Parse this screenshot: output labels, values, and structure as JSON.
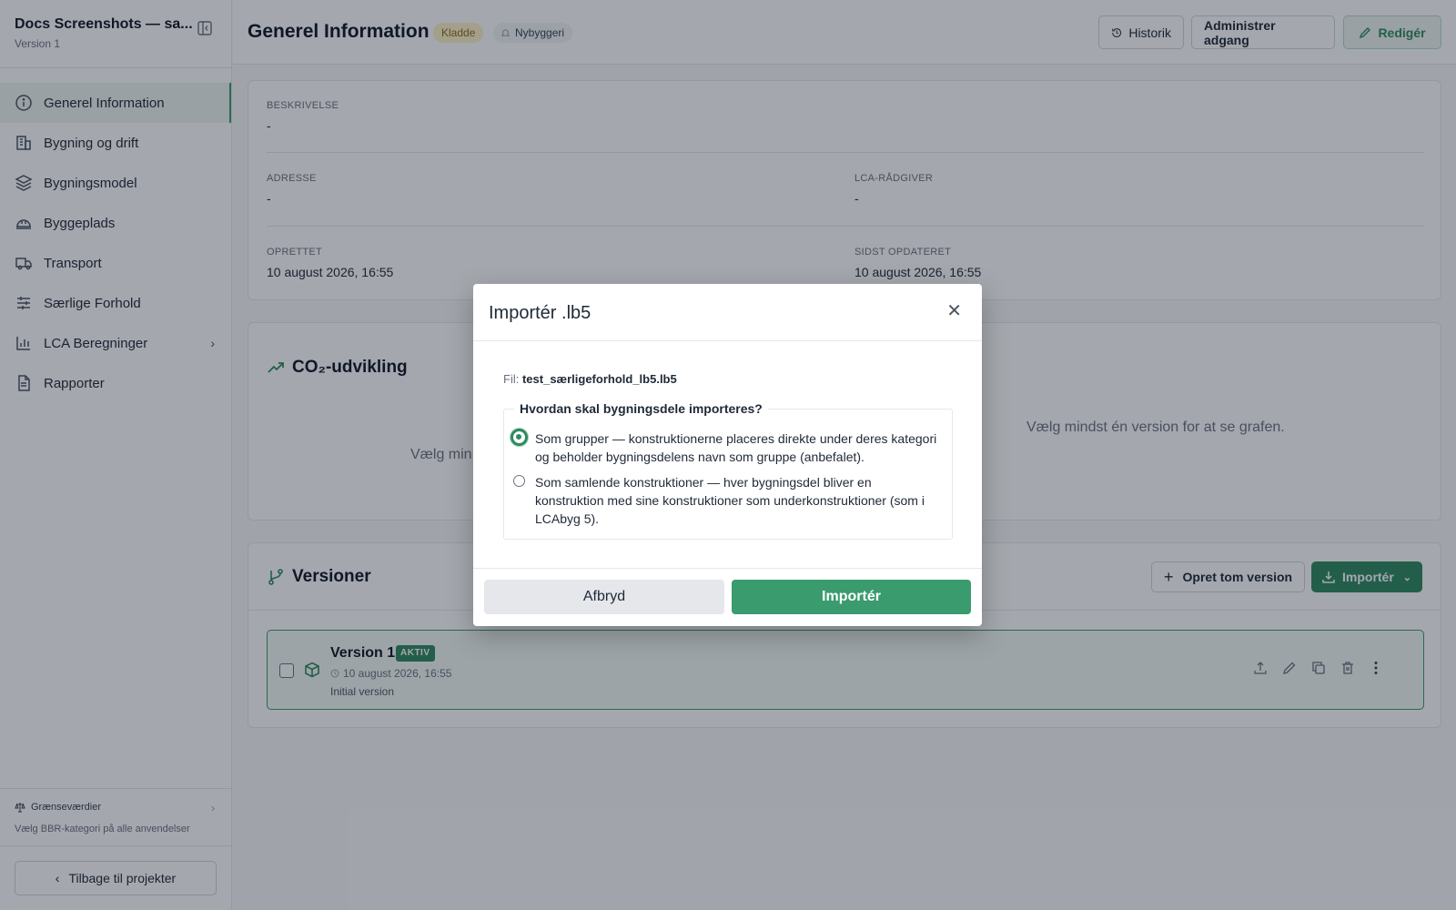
{
  "sidebar": {
    "title": "Docs Screenshots — sa...",
    "subtitle": "Version 1",
    "items": [
      {
        "label": "Generel Information"
      },
      {
        "label": "Bygning og drift"
      },
      {
        "label": "Bygningsmodel"
      },
      {
        "label": "Byggeplads"
      },
      {
        "label": "Transport"
      },
      {
        "label": "Særlige Forhold"
      },
      {
        "label": "LCA Beregninger"
      },
      {
        "label": "Rapporter"
      }
    ],
    "limits_title": "Grænseværdier",
    "limits_sub": "Vælg BBR-kategori på alle anvendelser",
    "back_label": "Tilbage til projekter"
  },
  "header": {
    "title": "Generel Information",
    "status_badge": "Kladde",
    "type_badge": "Nybyggeri",
    "history": "Historik",
    "admin": "Administrer adgang",
    "edit": "Redigér"
  },
  "info": {
    "desc_label": "BESKRIVELSE",
    "desc_value": "-",
    "address_label": "ADRESSE",
    "address_value": "-",
    "advisor_label": "LCA-RÅDGIVER",
    "advisor_value": "-",
    "created_label": "OPRETTET",
    "created_value": "10 august 2026, 16:55",
    "updated_label": "SIDST OPDATERET",
    "updated_value": "10 august 2026, 16:55"
  },
  "co2": {
    "title": "CO₂-udvikling",
    "msg_left": "Vælg min",
    "msg_right": "Vælg mindst én version for at se grafen."
  },
  "versions": {
    "title": "Versioner",
    "new_label": "Opret tom version",
    "import_label": "Importér",
    "rows": [
      {
        "name": "Version 1",
        "badge": "AKTIV",
        "date": "10 august 2026, 16:55",
        "desc": "Initial version"
      }
    ]
  },
  "modal": {
    "title": "Importér .lb5",
    "file_label": "Fil:",
    "file_name": "test_særligeforhold_lb5.lb5",
    "question": "Hvordan skal bygningsdele importeres?",
    "options": [
      {
        "label": "Som grupper — konstruktionerne placeres direkte under deres kategori og beholder bygningsdelens navn som gruppe (anbefalet).",
        "selected": true
      },
      {
        "label": "Som samlende konstruktioner — hver bygningsdel bliver en konstruktion med sine konstruktioner som underkonstruktioner (som i LCAbyg 5).",
        "selected": false
      }
    ],
    "cancel": "Afbryd",
    "confirm": "Importér"
  },
  "colors": {
    "accent": "#3a9b6e",
    "accent_dark": "#2f8a5f",
    "draft_badge_bg": "#fdf3c9"
  },
  "icons": {
    "nav": [
      "info-icon",
      "building-icon",
      "layers-icon",
      "hardhat-icon",
      "truck-icon",
      "sliders-icon",
      "bar-chart-icon",
      "file-text-icon"
    ]
  }
}
